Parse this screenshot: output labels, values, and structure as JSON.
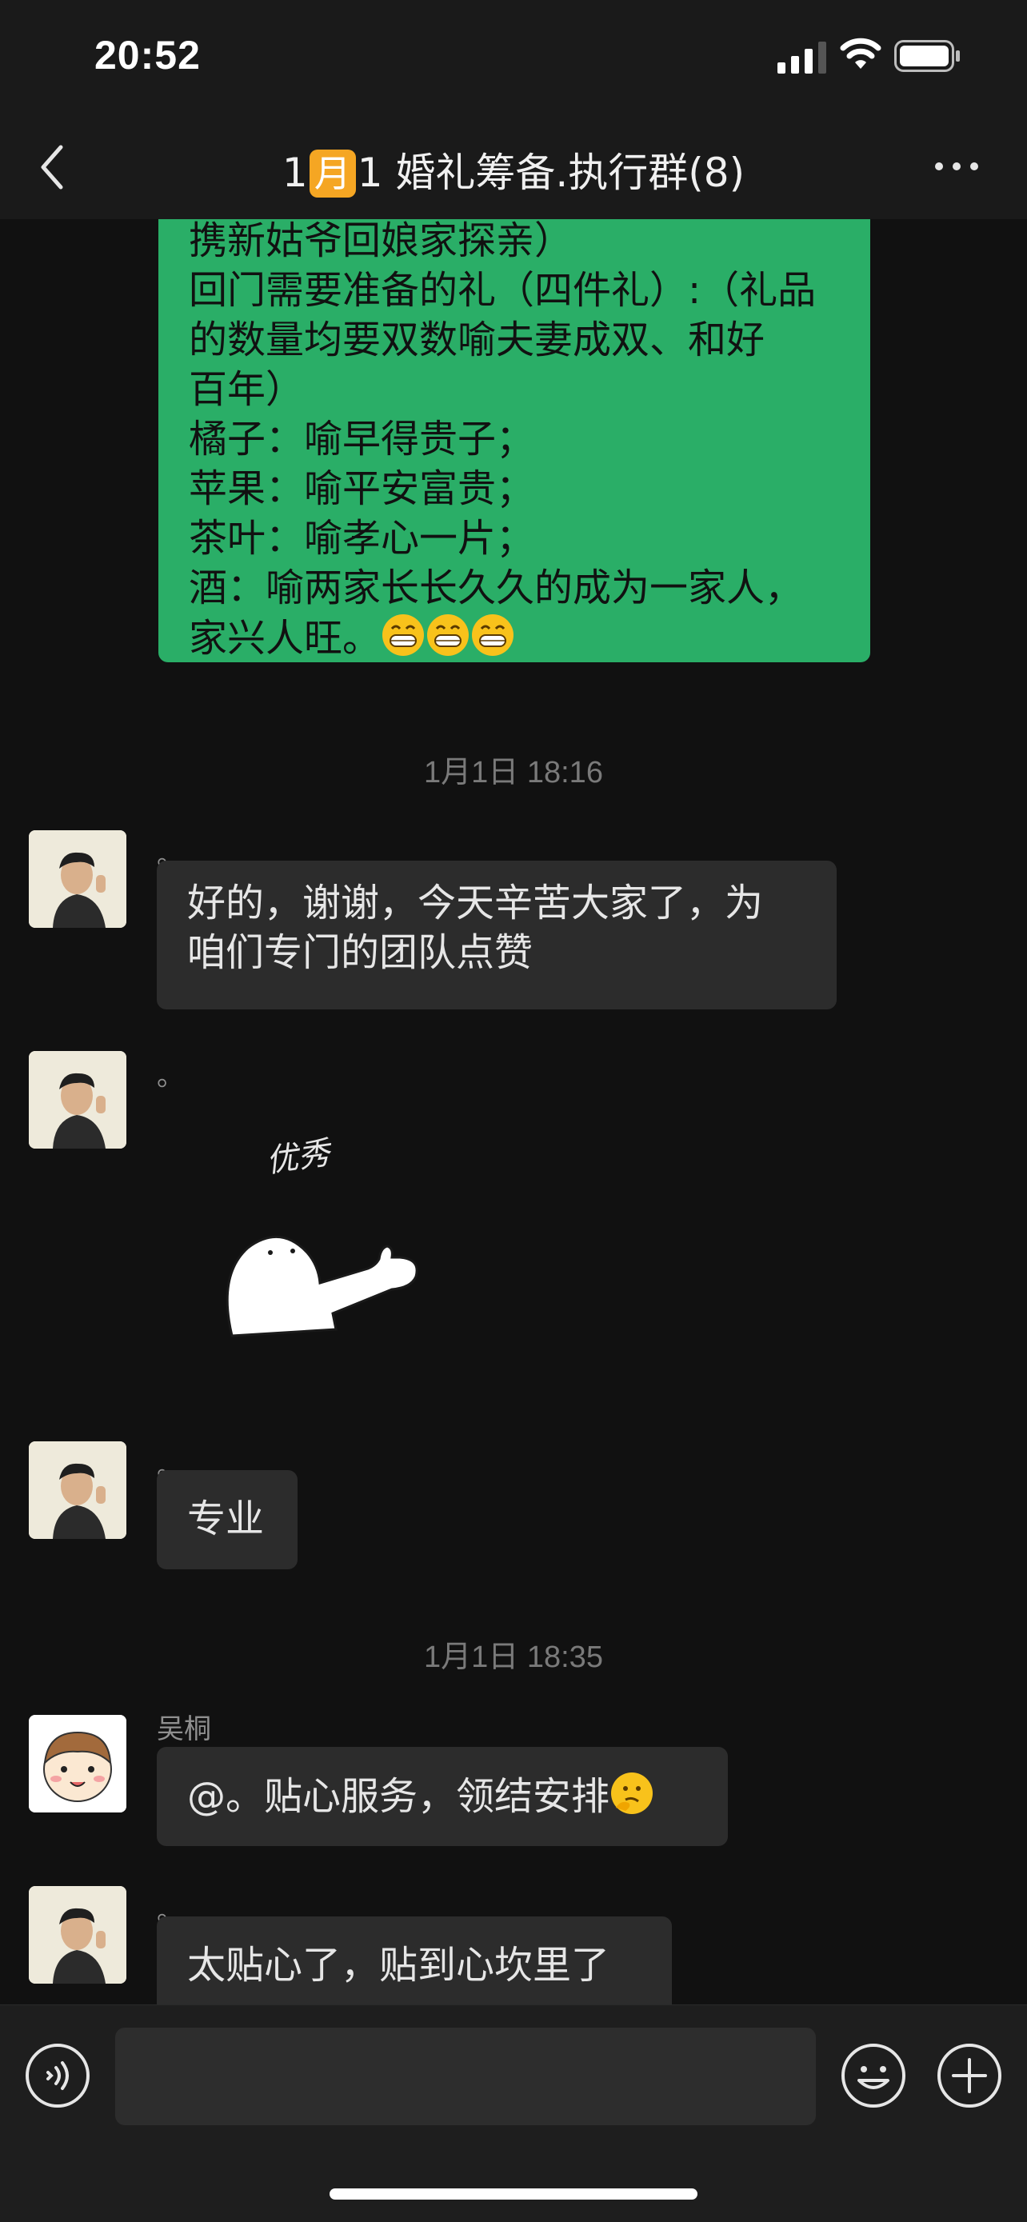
{
  "status_bar": {
    "time": "20:52"
  },
  "header": {
    "title_prefix": "1",
    "title_badge": "月",
    "title_suffix": "1 婚礼筹备.执行群(8)"
  },
  "messages": {
    "m1_lines": [
      "携新姑爷回娘家探亲）",
      "回门需要准备的礼（四件礼）:（礼品",
      "的数量均要双数喻夫妻成双、和好",
      "百年）",
      "橘子：喻早得贵子；",
      "苹果：喻平安富贵；",
      "茶叶：喻孝心一片；",
      "酒：喻两家长长久久的成为一家人，",
      "家兴人旺。"
    ],
    "ts1": "1月1日 18:16",
    "m2_sender": "。",
    "m2_lines": [
      "好的，谢谢，今天辛苦大家了，为",
      "咱们专门的团队点赞"
    ],
    "m3_sender": "。",
    "m3_sticker_text": "优秀",
    "m4_sender": "。",
    "m4_text": "专业",
    "ts2": "1月1日 18:35",
    "m5_sender": "吴桐",
    "m5_text": "@。贴心服务，领结安排",
    "m6_sender": "。",
    "m6_text": "太贴心了，贴到心坎里了"
  },
  "input": {
    "placeholder": ""
  },
  "icons": {
    "back": "back-chevron-icon",
    "more": "more-dots-icon",
    "voice": "voice-icon",
    "emoji": "emoji-icon",
    "plus": "plus-icon"
  },
  "colors": {
    "own_bubble": "#2aae67",
    "other_bubble": "#2c2c2c",
    "background": "#111111"
  }
}
